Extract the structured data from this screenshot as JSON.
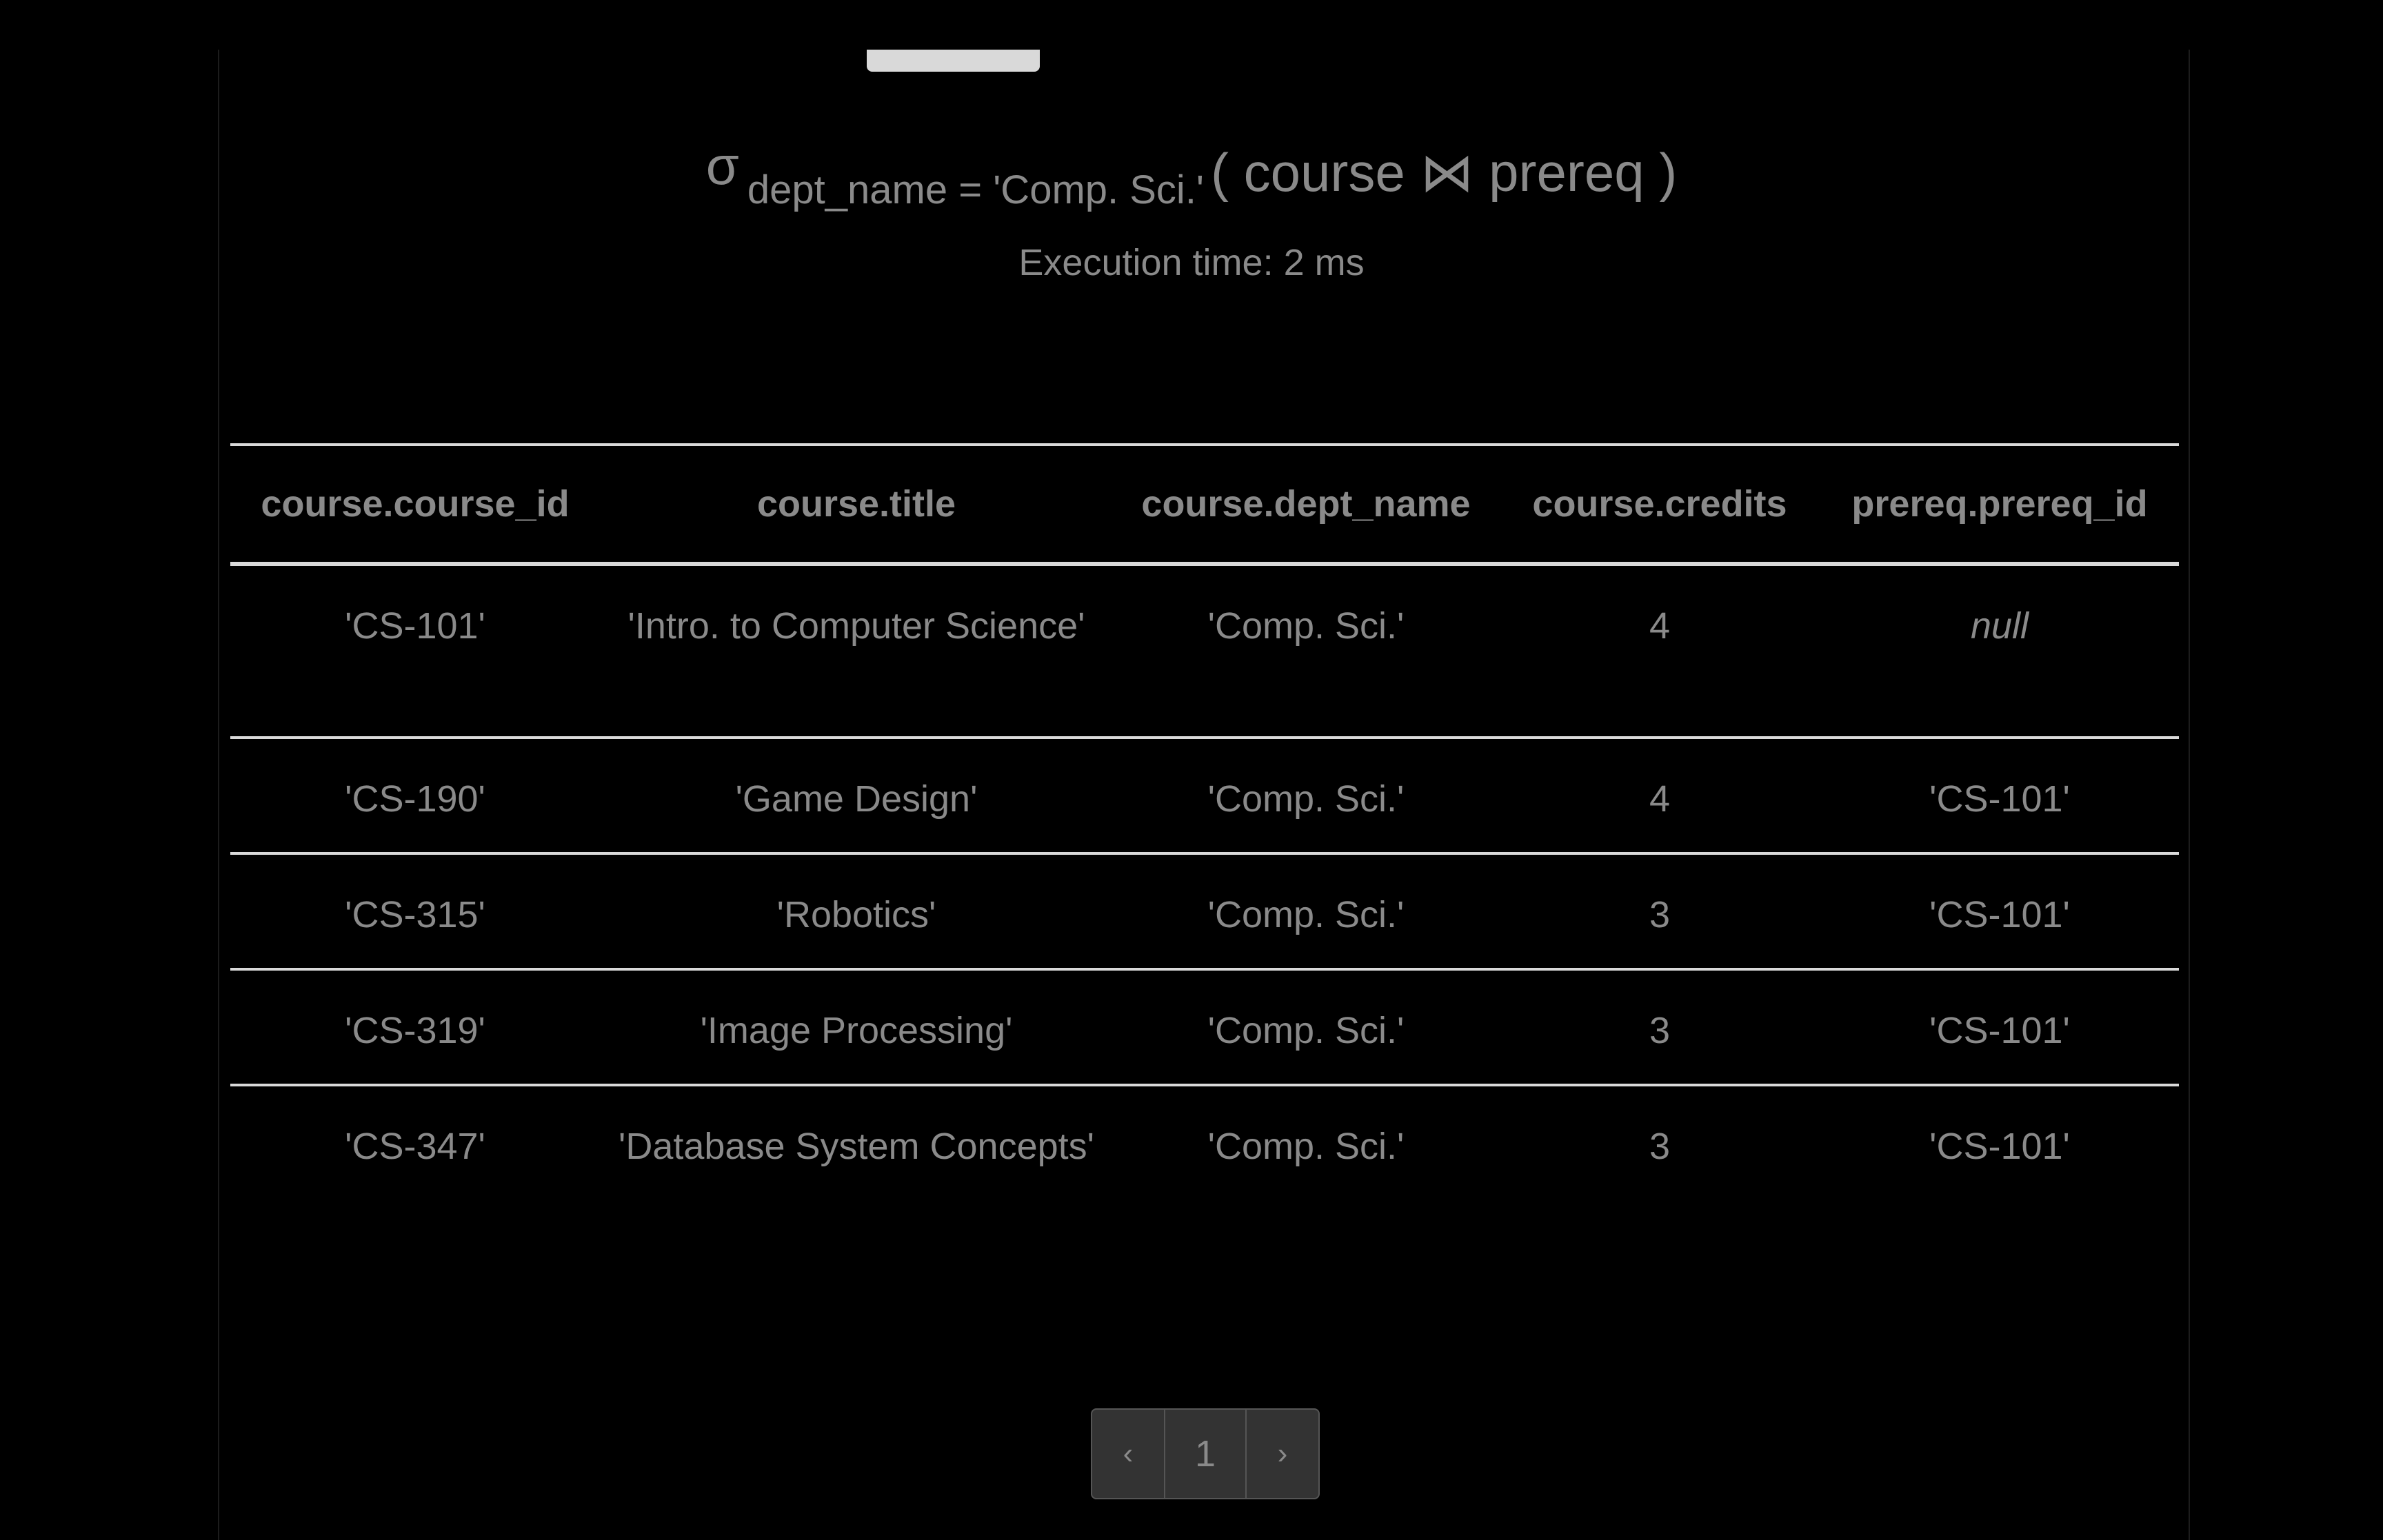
{
  "query": {
    "sigma": "σ",
    "condition": "dept_name = 'Comp. Sci.'",
    "relation": "( course ⋈ prereq )",
    "execution_time": "Execution time: 2 ms"
  },
  "table": {
    "headers": [
      "course.course_id",
      "course.title",
      "course.dept_name",
      "course.credits",
      "prereq.prereq_id"
    ],
    "rows": [
      [
        "'CS-101'",
        "'Intro. to Computer Science'",
        "'Comp. Sci.'",
        "4",
        "null"
      ],
      [
        "'CS-190'",
        "'Game Design'",
        "'Comp. Sci.'",
        "4",
        "'CS-101'"
      ],
      [
        "'CS-315'",
        "'Robotics'",
        "'Comp. Sci.'",
        "3",
        "'CS-101'"
      ],
      [
        "'CS-319'",
        "'Image Processing'",
        "'Comp. Sci.'",
        "3",
        "'CS-101'"
      ],
      [
        "'CS-347'",
        "'Database System Concepts'",
        "'Comp. Sci.'",
        "3",
        "'CS-101'"
      ]
    ]
  },
  "pagination": {
    "prev_label": "‹",
    "current_page": "1",
    "next_label": "›"
  }
}
